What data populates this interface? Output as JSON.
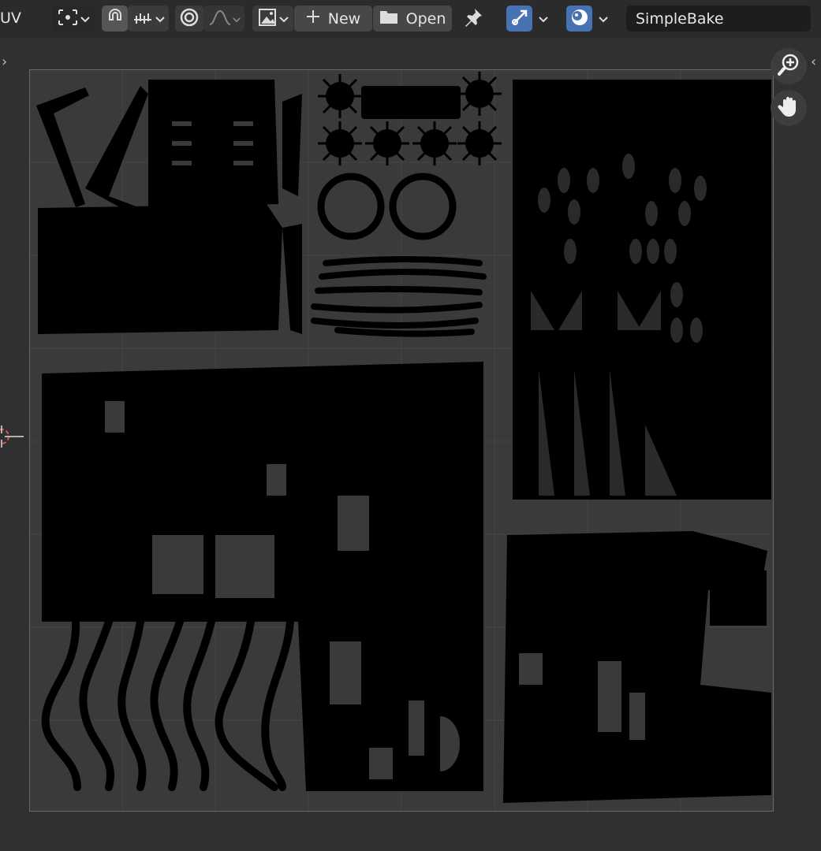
{
  "header": {
    "editor_label": "UV",
    "new_label": "New",
    "open_label": "Open",
    "image_name": "SimpleBake"
  },
  "colors": {
    "header_bg": "#2b2b2b",
    "viewport_bg": "#303030",
    "uv_area_bg": "#3a3a3a",
    "active_blue": "#4772b3",
    "uv_island": "#000000"
  },
  "icons": [
    "pivot-icon",
    "snap-icon",
    "snap-increment-icon",
    "proportional-edit-icon",
    "falloff-curve-icon",
    "image-browse-icon",
    "plus-icon",
    "folder-icon",
    "pin-icon",
    "uv-sync-icon",
    "overlay-icon",
    "zoom-icon",
    "hand-icon"
  ]
}
